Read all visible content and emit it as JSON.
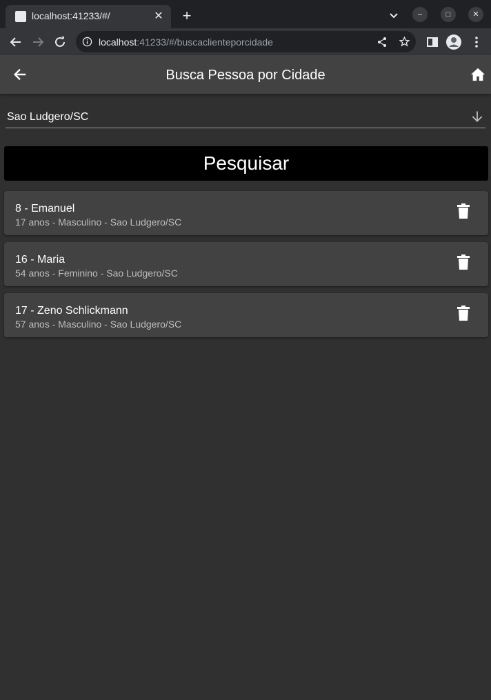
{
  "browser": {
    "tab_title": "localhost:41233/#/",
    "url_host": "localhost",
    "url_rest": ":41233/#/buscaclienteporcidade"
  },
  "appbar": {
    "title": "Busca Pessoa por Cidade"
  },
  "city_select": {
    "value": "Sao Ludgero/SC"
  },
  "search_button": {
    "label": "Pesquisar"
  },
  "results": [
    {
      "title": "8 - Emanuel",
      "subtitle": "17 anos - Masculino - Sao Ludgero/SC"
    },
    {
      "title": "16 - Maria",
      "subtitle": "54 anos - Feminino - Sao Ludgero/SC"
    },
    {
      "title": "17 - Zeno Schlickmann",
      "subtitle": "57 anos - Masculino - Sao Ludgero/SC"
    }
  ],
  "icons": {
    "back": "arrow-back-icon",
    "home": "home-icon",
    "dropdown": "arrow-down-icon",
    "delete": "trash-icon"
  },
  "colors": {
    "background": "#303030",
    "appbar": "#424242",
    "card": "#424242",
    "button": "#000000"
  }
}
